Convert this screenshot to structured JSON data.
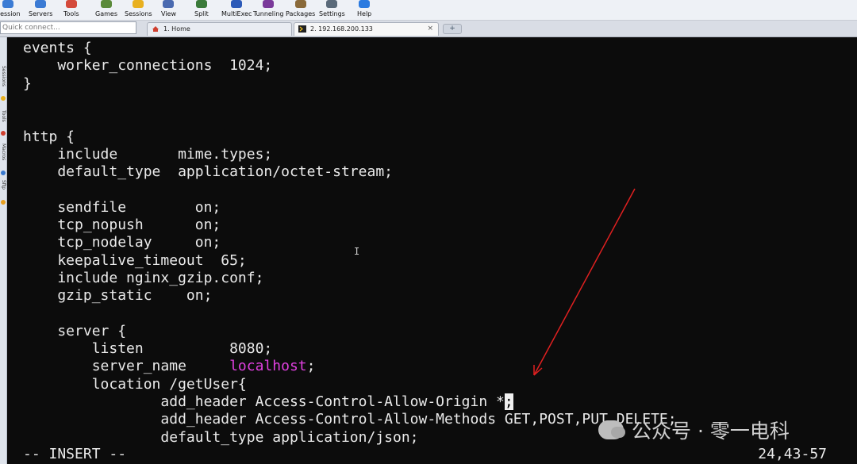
{
  "toolbar": {
    "items": [
      {
        "label": "Session",
        "icon": "session-icon",
        "color": "#3b7bd4"
      },
      {
        "label": "Servers",
        "icon": "servers-icon",
        "color": "#3b7bd4"
      },
      {
        "label": "Tools",
        "icon": "tools-icon",
        "color": "#d44a3b"
      },
      {
        "label": "Games",
        "icon": "games-icon",
        "color": "#5a8a3a"
      },
      {
        "label": "Sessions",
        "icon": "sessions-star-icon",
        "color": "#e8b020"
      },
      {
        "label": "View",
        "icon": "view-icon",
        "color": "#4a6ab0"
      },
      {
        "label": "Split",
        "icon": "split-icon",
        "color": "#3a7a3a"
      },
      {
        "label": "MultiExec",
        "icon": "multiexec-icon",
        "color": "#2c5ab8"
      },
      {
        "label": "Tunneling",
        "icon": "tunneling-icon",
        "color": "#7a3a9a"
      },
      {
        "label": "Packages",
        "icon": "packages-icon",
        "color": "#8a6a3a"
      },
      {
        "label": "Settings",
        "icon": "settings-gear-icon",
        "color": "#5a6a7a"
      },
      {
        "label": "Help",
        "icon": "help-icon",
        "color": "#2a7ae0"
      }
    ]
  },
  "tabs": {
    "quick_connect_placeholder": "Quick connect...",
    "home_tab": "1. Home",
    "ssh_tab": "2. 192.168.200.133",
    "close_symbol": "×",
    "new_tab_symbol": "+"
  },
  "sidebar": {
    "labels": [
      "Sessions",
      "Tools",
      "Macros",
      "Sftp"
    ]
  },
  "terminal": {
    "lines": [
      {
        "text": "events {"
      },
      {
        "text": "    worker_connections  1024;"
      },
      {
        "text": "}"
      },
      {
        "text": ""
      },
      {
        "text": ""
      },
      {
        "text": "http {"
      },
      {
        "text": "    include       mime.types;"
      },
      {
        "text": "    default_type  application/octet-stream;"
      },
      {
        "text": ""
      },
      {
        "text": "    sendfile        on;"
      },
      {
        "text": "    tcp_nopush      on;"
      },
      {
        "text": "    tcp_nodelay     on;"
      },
      {
        "text": "    keepalive_timeout  65;"
      },
      {
        "text": "    include nginx_gzip.conf;"
      },
      {
        "text": "    gzip_static    on;"
      },
      {
        "text": ""
      },
      {
        "text": "    server {"
      },
      {
        "text": "        listen          8080;"
      },
      {
        "text": "        server_name     ",
        "highlight": "localhost",
        "after": ";"
      },
      {
        "text": "        location /getUser{"
      },
      {
        "text": "                add_header Access-Control-Allow-Origin *",
        "cursor": ";"
      },
      {
        "text": "                add_header Access-Control-Allow-Methods GET,POST,PUT,DELETE;"
      },
      {
        "text": "                default_type application/json;"
      }
    ],
    "mode": "-- INSERT --",
    "position": "24,43-57"
  },
  "watermark": {
    "text": "公众号 · 零一电科"
  },
  "colors": {
    "terminal_bg": "#0c0c0c",
    "text": "#eaeaea",
    "keyword_magenta": "#e040e0",
    "arrow_red": "#e02020"
  }
}
